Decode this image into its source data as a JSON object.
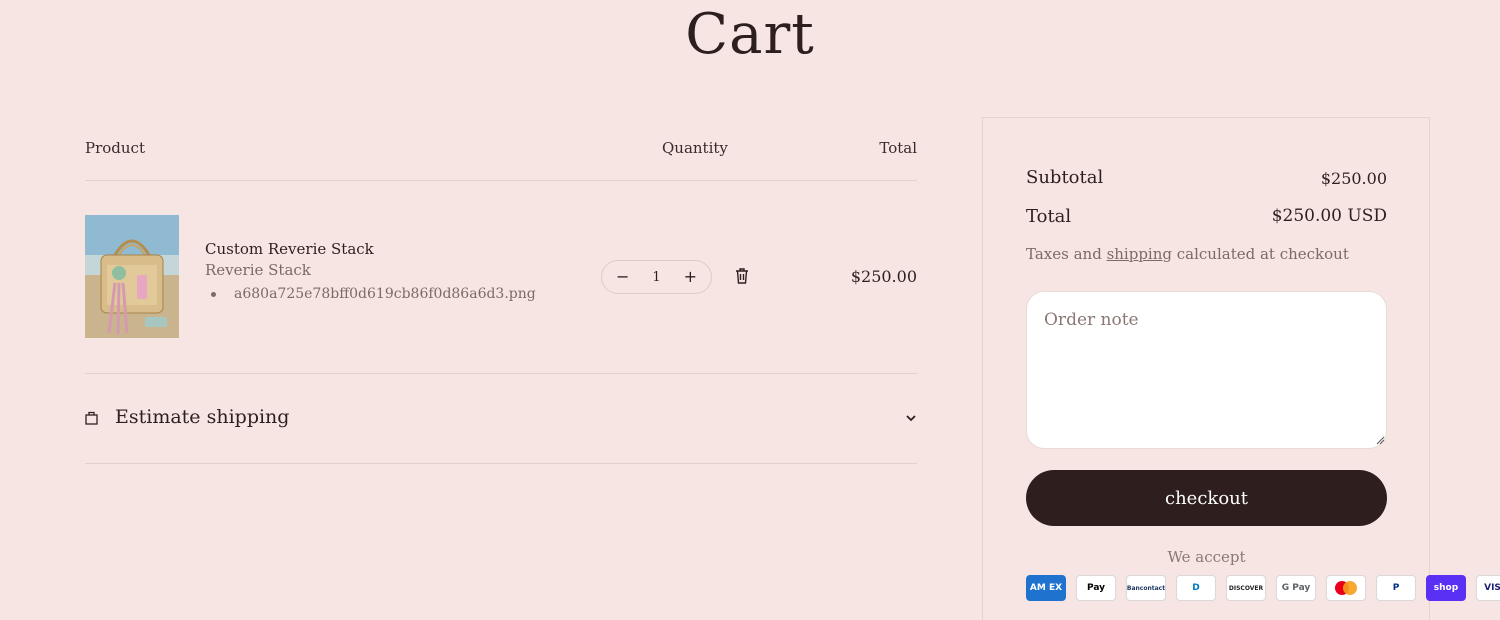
{
  "page": {
    "title": "Cart"
  },
  "table": {
    "headers": {
      "product": "Product",
      "quantity": "Quantity",
      "total": "Total"
    }
  },
  "items": [
    {
      "name": "Custom Reverie Stack",
      "variant": "Reverie Stack",
      "property": "a680a725e78bff0d619cb86f0d86a6d3.png",
      "quantity": "1",
      "line_total": "$250.00",
      "image": "handbag-photo"
    }
  ],
  "shipping": {
    "label": "Estimate shipping"
  },
  "summary": {
    "subtotal_label": "Subtotal",
    "subtotal_value": "$250.00",
    "total_label": "Total",
    "total_value": "$250.00 USD",
    "tax_prefix": "Taxes and ",
    "tax_link": "shipping",
    "tax_suffix": " calculated at checkout",
    "note_placeholder": "Order note",
    "checkout_label": "checkout",
    "accept_label": "We accept"
  },
  "payments": [
    {
      "label": "AM EX",
      "icon": "amex-icon",
      "bg": "#1f72cd",
      "fg": "#ffffff"
    },
    {
      "label": "Pay",
      "icon": "apple-pay-icon",
      "bg": "#ffffff",
      "fg": "#000000"
    },
    {
      "label": "Bancontact",
      "icon": "bancontact-icon",
      "bg": "#ffffff",
      "fg": "#1e3764"
    },
    {
      "label": "D",
      "icon": "diners-club-icon",
      "bg": "#ffffff",
      "fg": "#0079be"
    },
    {
      "label": "DISCOVER",
      "icon": "discover-icon",
      "bg": "#ffffff",
      "fg": "#231f20"
    },
    {
      "label": "G Pay",
      "icon": "google-pay-icon",
      "bg": "#ffffff",
      "fg": "#5f6368"
    },
    {
      "label": "",
      "icon": "mastercard-icon",
      "bg": "#ffffff",
      "fg": "#eb001b"
    },
    {
      "label": "P",
      "icon": "paypal-icon",
      "bg": "#ffffff",
      "fg": "#003087"
    },
    {
      "label": "shop",
      "icon": "shop-pay-icon",
      "bg": "#5a31f4",
      "fg": "#ffffff"
    },
    {
      "label": "VISA",
      "icon": "visa-icon",
      "bg": "#ffffff",
      "fg": "#1a1f71"
    }
  ],
  "colors": {
    "background": "#f6e5e3",
    "text": "#2e1f1f",
    "muted": "#7c6a68",
    "button": "#2e1e1e"
  }
}
